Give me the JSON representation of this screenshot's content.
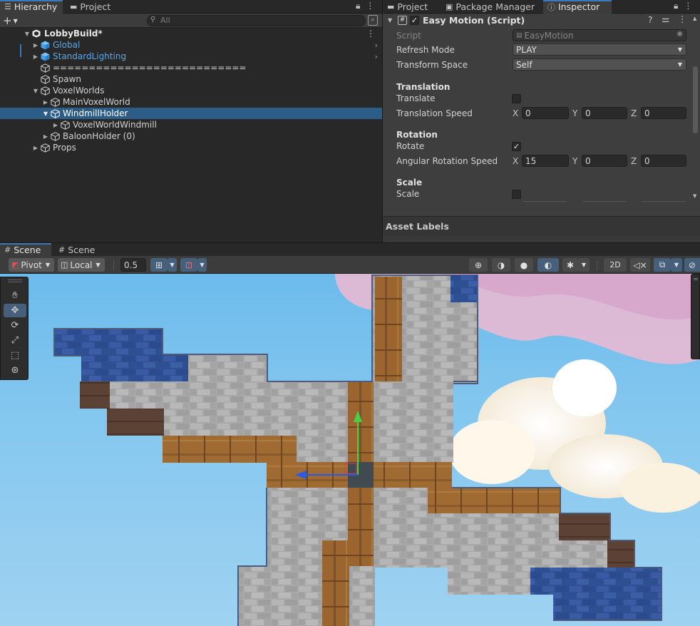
{
  "hierarchy": {
    "tab_label": "Hierarchy",
    "project_tab": "Project",
    "search_placeholder": "All",
    "add_label": "+",
    "items": [
      {
        "label": "LobbyBuild*",
        "depth": 0,
        "expanded": true,
        "type": "scene",
        "blue": false
      },
      {
        "label": "Global",
        "depth": 1,
        "expanded": false,
        "type": "prefab",
        "blue": true
      },
      {
        "label": "StandardLighting",
        "depth": 1,
        "expanded": false,
        "type": "prefab",
        "blue": true
      },
      {
        "label": "===========================",
        "depth": 1,
        "expanded": null,
        "type": "object",
        "blue": false
      },
      {
        "label": "Spawn",
        "depth": 1,
        "expanded": null,
        "type": "object",
        "blue": false
      },
      {
        "label": "VoxelWorlds",
        "depth": 1,
        "expanded": true,
        "type": "object",
        "blue": false
      },
      {
        "label": "MainVoxelWorld",
        "depth": 2,
        "expanded": false,
        "type": "object",
        "blue": false
      },
      {
        "label": "WindmillHolder",
        "depth": 2,
        "expanded": true,
        "type": "object",
        "blue": false,
        "selected": true
      },
      {
        "label": "VoxelWorldWindmill",
        "depth": 3,
        "expanded": false,
        "type": "object",
        "blue": false
      },
      {
        "label": "BaloonHolder (0)",
        "depth": 2,
        "expanded": false,
        "type": "object",
        "blue": false
      },
      {
        "label": "Props",
        "depth": 1,
        "expanded": false,
        "type": "object",
        "blue": false
      }
    ]
  },
  "tabs": {
    "project": "Project",
    "package_manager": "Package Manager",
    "inspector": "Inspector"
  },
  "inspector": {
    "component_title": "Easy Motion (Script)",
    "script_label": "Script",
    "script_value": "EasyMotion",
    "refresh_mode_label": "Refresh Mode",
    "refresh_mode_value": "PLAY",
    "transform_space_label": "Transform Space",
    "transform_space_value": "Self",
    "translation_header": "Translation",
    "translate_label": "Translate",
    "translate_checked": false,
    "translation_speed_label": "Translation Speed",
    "translation_speed": {
      "x": "0",
      "y": "0",
      "z": "0"
    },
    "rotation_header": "Rotation",
    "rotate_label": "Rotate",
    "rotate_checked": true,
    "angular_speed_label": "Angular Rotation Speed",
    "angular_speed": {
      "x": "15",
      "y": "0",
      "z": "0"
    },
    "scale_header": "Scale",
    "scale_label": "Scale",
    "scale_checked": false,
    "axis_x": "X",
    "axis_y": "Y",
    "axis_z": "Z",
    "asset_labels": "Asset Labels"
  },
  "scene": {
    "tab1": "Scene",
    "tab2": "Scene",
    "pivot_label": "Pivot",
    "local_label": "Local",
    "grid_value": "0.5",
    "mode_2d": "2D"
  },
  "colors": {
    "selection": "#2c5d87",
    "accent": "#3a79bb",
    "prefab_blue": "#5aa7ea",
    "sky": "#84c7ef"
  }
}
